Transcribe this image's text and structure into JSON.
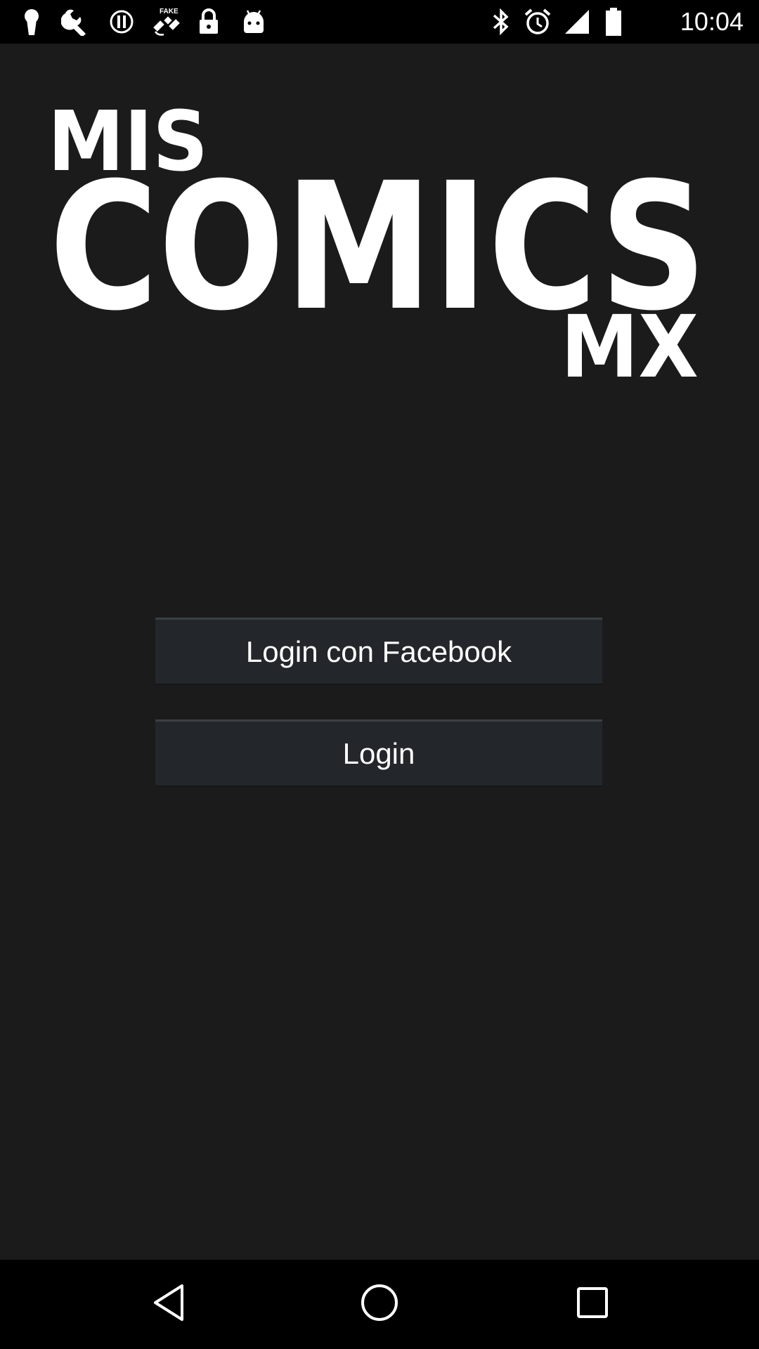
{
  "status_bar": {
    "time": "10:04",
    "left_icons": [
      "keyhole-icon",
      "wrench-icon",
      "alert-icon",
      "satellite-fake-gps-icon",
      "lock-icon",
      "android-icon"
    ],
    "fake_label": "FAKE",
    "right_icons": [
      "bluetooth-icon",
      "alarm-icon",
      "signal-icon",
      "battery-icon"
    ]
  },
  "app": {
    "background_color": "#1b1b1b",
    "logo": {
      "line1": "MIS",
      "line2": "COMICS",
      "line3": "MX"
    },
    "buttons": {
      "facebook_label": "Login con Facebook",
      "login_label": "Login"
    }
  },
  "nav_bar": {
    "items": [
      "back-icon",
      "home-icon",
      "recents-icon"
    ]
  }
}
